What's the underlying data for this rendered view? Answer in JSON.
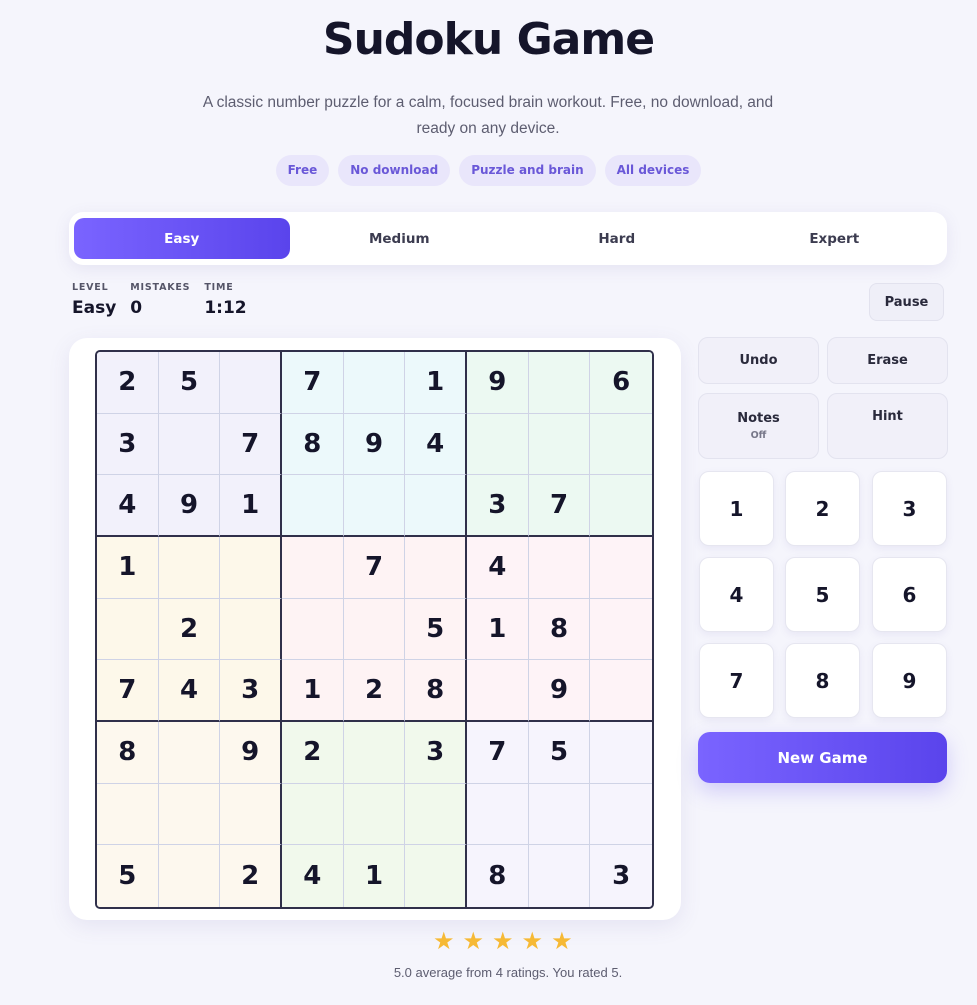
{
  "header": {
    "title": "Sudoku Game",
    "subtitle": "A classic number puzzle for a calm, focused brain workout. Free, no download, and ready on any device.",
    "tags": [
      "Free",
      "No download",
      "Puzzle and brain",
      "All devices"
    ]
  },
  "difficulty": {
    "options": [
      "Easy",
      "Medium",
      "Hard",
      "Expert"
    ],
    "selected": "Easy"
  },
  "stats": {
    "level_label": "LEVEL",
    "level_value": "Easy",
    "mistakes_label": "MISTAKES",
    "mistakes_value": "0",
    "time_label": "TIME",
    "time_value": "1:12"
  },
  "controls": {
    "pause": "Pause",
    "undo": "Undo",
    "erase": "Erase",
    "notes": "Notes",
    "notes_state": "Off",
    "hint": "Hint",
    "new_game": "New Game"
  },
  "numpad": [
    "1",
    "2",
    "3",
    "4",
    "5",
    "6",
    "7",
    "8",
    "9"
  ],
  "board": [
    [
      "2",
      "5",
      "",
      "7",
      "",
      "1",
      "9",
      "",
      "6"
    ],
    [
      "3",
      "",
      "7",
      "8",
      "9",
      "4",
      "",
      "",
      ""
    ],
    [
      "4",
      "9",
      "1",
      "",
      "",
      "",
      "3",
      "7",
      ""
    ],
    [
      "1",
      "",
      "",
      "",
      "7",
      "",
      "4",
      "",
      ""
    ],
    [
      "",
      "2",
      "",
      "",
      "",
      "5",
      "1",
      "8",
      ""
    ],
    [
      "7",
      "4",
      "3",
      "1",
      "2",
      "8",
      "",
      "9",
      ""
    ],
    [
      "8",
      "",
      "9",
      "2",
      "",
      "3",
      "7",
      "5",
      ""
    ],
    [
      "",
      "",
      "",
      "",
      "",
      "",
      "",
      "",
      ""
    ],
    [
      "5",
      "",
      "2",
      "4",
      "1",
      "",
      "8",
      "",
      "3"
    ]
  ],
  "box_colors": [
    "#f2f1fb",
    "#ecf9fb",
    "#ecf9f2",
    "#fdf8ea",
    "#fef3f4",
    "#fef3f7",
    "#fdf8ee",
    "#f1f9ec",
    "#f6f4fd"
  ],
  "rating": {
    "stars": 5,
    "text": "5.0 average from 4 ratings. You rated 5."
  }
}
